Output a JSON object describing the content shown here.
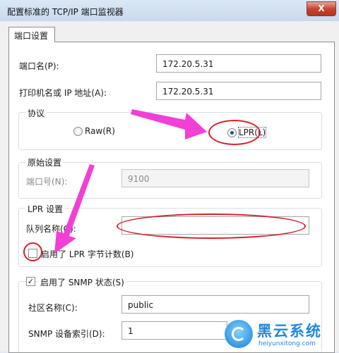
{
  "window": {
    "title": "配置标准的 TCP/IP 端口监视器",
    "close_label": "X"
  },
  "tab": {
    "label": "端口设置"
  },
  "port_name": {
    "label": "端口名(P):",
    "value": "172.20.5.31"
  },
  "printer_name_ip": {
    "label": "打印机名或 IP 地址(A):",
    "value": "172.20.5.31"
  },
  "protocol": {
    "group_label": "协议",
    "raw_label": "Raw(R)",
    "lpr_label": "LPR(L)",
    "selected": "LPR"
  },
  "raw_settings": {
    "group_label": "原始设置",
    "port_number_label": "端口号(N):",
    "port_number_value": "9100"
  },
  "lpr_settings": {
    "group_label": "LPR 设置",
    "queue_name_label": "队列名称(Q):",
    "queue_name_value": "",
    "byte_count_label": "启用了 LPR 字节计数(B)",
    "byte_count_checked": false
  },
  "snmp": {
    "status_label": "启用了 SNMP 状态(S)",
    "status_checked": true,
    "community_label": "社区名称(C):",
    "community_value": "public",
    "device_index_label": "SNMP 设备索引(D):",
    "device_index_value": "1"
  },
  "watermark": {
    "brand": "黑云系统",
    "url": "heiyunxitong.com"
  },
  "colors": {
    "annotation_red": "#d41f2a",
    "annotation_magenta": "#f23fd6",
    "accent": "#2189dd"
  }
}
